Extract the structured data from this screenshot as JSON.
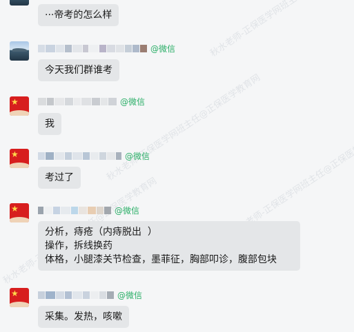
{
  "messages": [
    {
      "id": "m0",
      "sender_suffix": "",
      "lines": [
        "···帝考的怎么样"
      ]
    },
    {
      "id": "m1",
      "sender_suffix": "@微信",
      "lines": [
        "今天我们群谁考"
      ]
    },
    {
      "id": "m2",
      "sender_suffix": "@微信",
      "lines": [
        "我"
      ]
    },
    {
      "id": "m3",
      "sender_suffix": "@微信",
      "lines": [
        "考过了"
      ]
    },
    {
      "id": "m4",
      "sender_suffix": "@微信",
      "lines": [
        "分析，痔疮（内痔脱出  ）",
        "操作，拆线换药",
        "体格，小腿漆关节检查，墨菲征，胸部叩诊，腹部包块"
      ]
    },
    {
      "id": "m5",
      "sender_suffix": "@微信",
      "lines": [
        "采集。发热，咳嗽"
      ]
    }
  ],
  "bubble_texts": {
    "m0": "···帝考的怎么样",
    "m1": "今天我们群谁考",
    "m2": "我",
    "m3": "考过了",
    "m4": "分析，痔疮（内痔脱出  ）\n操作，拆线换药\n体格，小腿漆关节检查，墨菲征，胸部叩诊，腹部包块",
    "m5": "采集。发热，咳嗽"
  },
  "watermark_text": "秋水老师-正保医学网班主任@正保医学教育网",
  "colors": {
    "background": "#f5f6f7",
    "bubble": "#e4e6e8",
    "wechat_tag": "#2aae67",
    "watermark": "#cfd4da"
  },
  "icons": [
    "flag-avatar-icon",
    "landscape-avatar-icon"
  ]
}
